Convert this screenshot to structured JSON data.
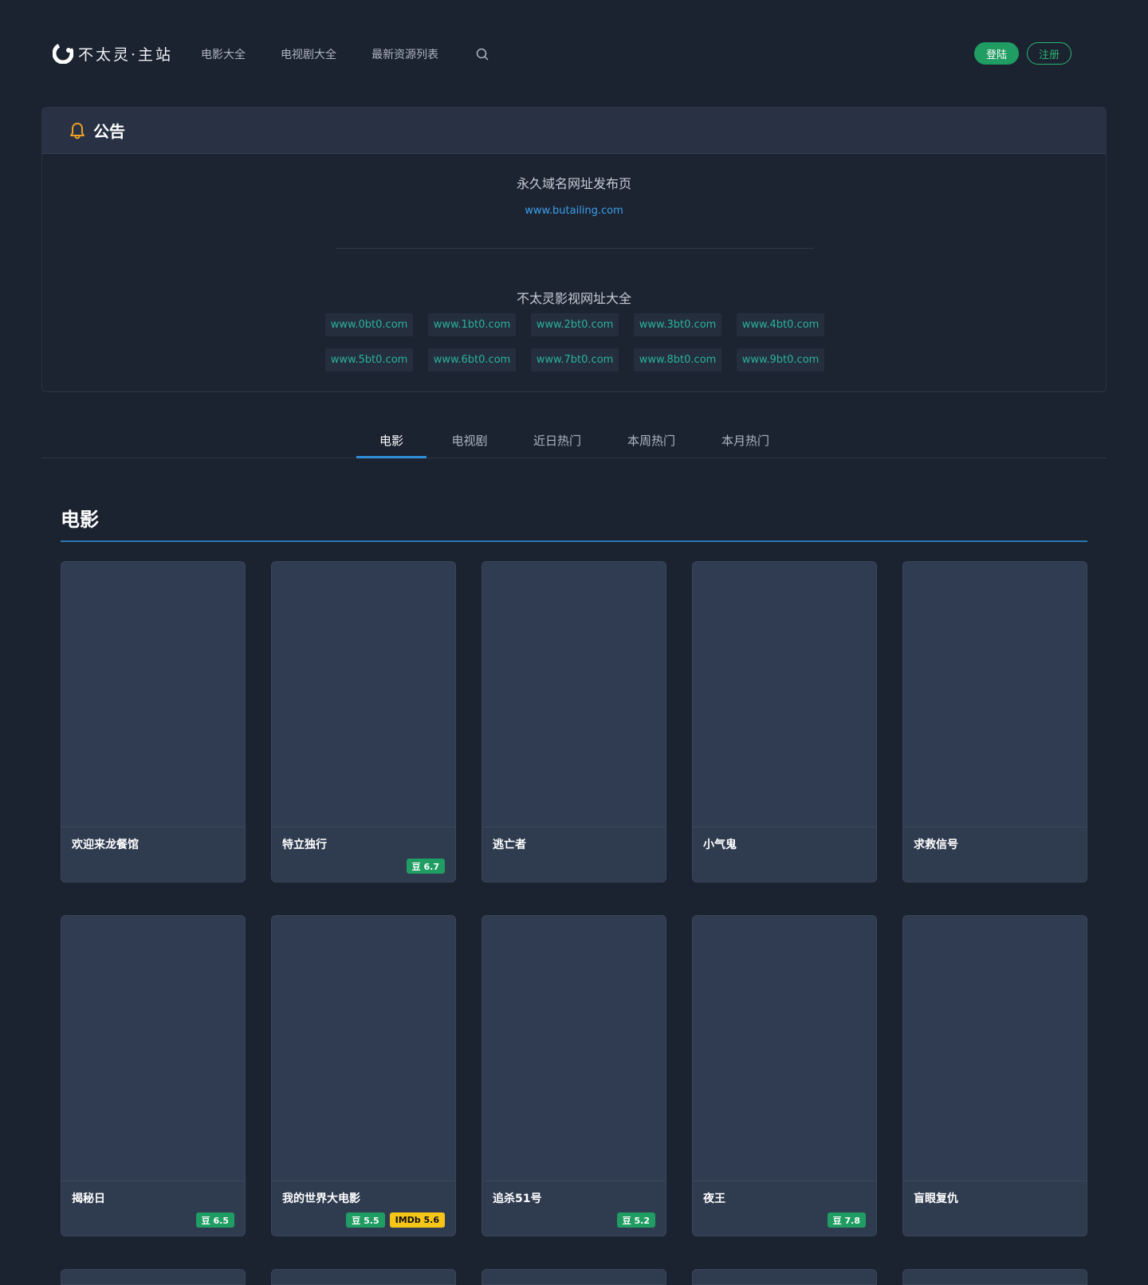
{
  "site": {
    "logo_text": "不太灵·主站"
  },
  "nav": {
    "links": [
      "电影大全",
      "电视剧大全",
      "最新资源列表"
    ],
    "search_icon": "search-icon",
    "login": "登陆",
    "register": "注册"
  },
  "notice": {
    "title": "公告",
    "icon": "bell-icon",
    "permanent_label": "永久域名网址发布页",
    "permanent_domain": "www.butailing.com",
    "mirrors_label": "不太灵影视网址大全",
    "mirrors": [
      "www.0bt0.com",
      "www.1bt0.com",
      "www.2bt0.com",
      "www.3bt0.com",
      "www.4bt0.com",
      "www.5bt0.com",
      "www.6bt0.com",
      "www.7bt0.com",
      "www.8bt0.com",
      "www.9bt0.com"
    ]
  },
  "tabs": [
    {
      "label": "电影",
      "active": true
    },
    {
      "label": "电视剧",
      "active": false
    },
    {
      "label": "近日热门",
      "active": false
    },
    {
      "label": "本周热门",
      "active": false
    },
    {
      "label": "本月热门",
      "active": false
    }
  ],
  "section": {
    "title": "电影",
    "movies": [
      {
        "title": "欢迎来龙餐馆",
        "douban": "",
        "imdb": ""
      },
      {
        "title": "特立独行",
        "douban": "豆 6.7",
        "imdb": ""
      },
      {
        "title": "逃亡者",
        "douban": "",
        "imdb": ""
      },
      {
        "title": "小气鬼",
        "douban": "",
        "imdb": ""
      },
      {
        "title": "求救信号",
        "douban": "",
        "imdb": ""
      },
      {
        "title": "揭秘日",
        "douban": "豆 6.5",
        "imdb": ""
      },
      {
        "title": "我的世界大电影",
        "douban": "豆 5.5",
        "imdb": "IMDb 5.6"
      },
      {
        "title": "追杀51号",
        "douban": "豆 5.2",
        "imdb": ""
      },
      {
        "title": "夜王",
        "douban": "豆 7.8",
        "imdb": ""
      },
      {
        "title": "盲眼复仇",
        "douban": "",
        "imdb": ""
      }
    ]
  },
  "colors": {
    "background": "#1b2230",
    "accent_green": "#1f9d62",
    "link_blue": "#3aa0ea",
    "mirror_teal": "#2bb39a",
    "tab_active": "#2f8fd8",
    "imdb_yellow": "#f5c518",
    "bell_orange": "#f0a020"
  }
}
